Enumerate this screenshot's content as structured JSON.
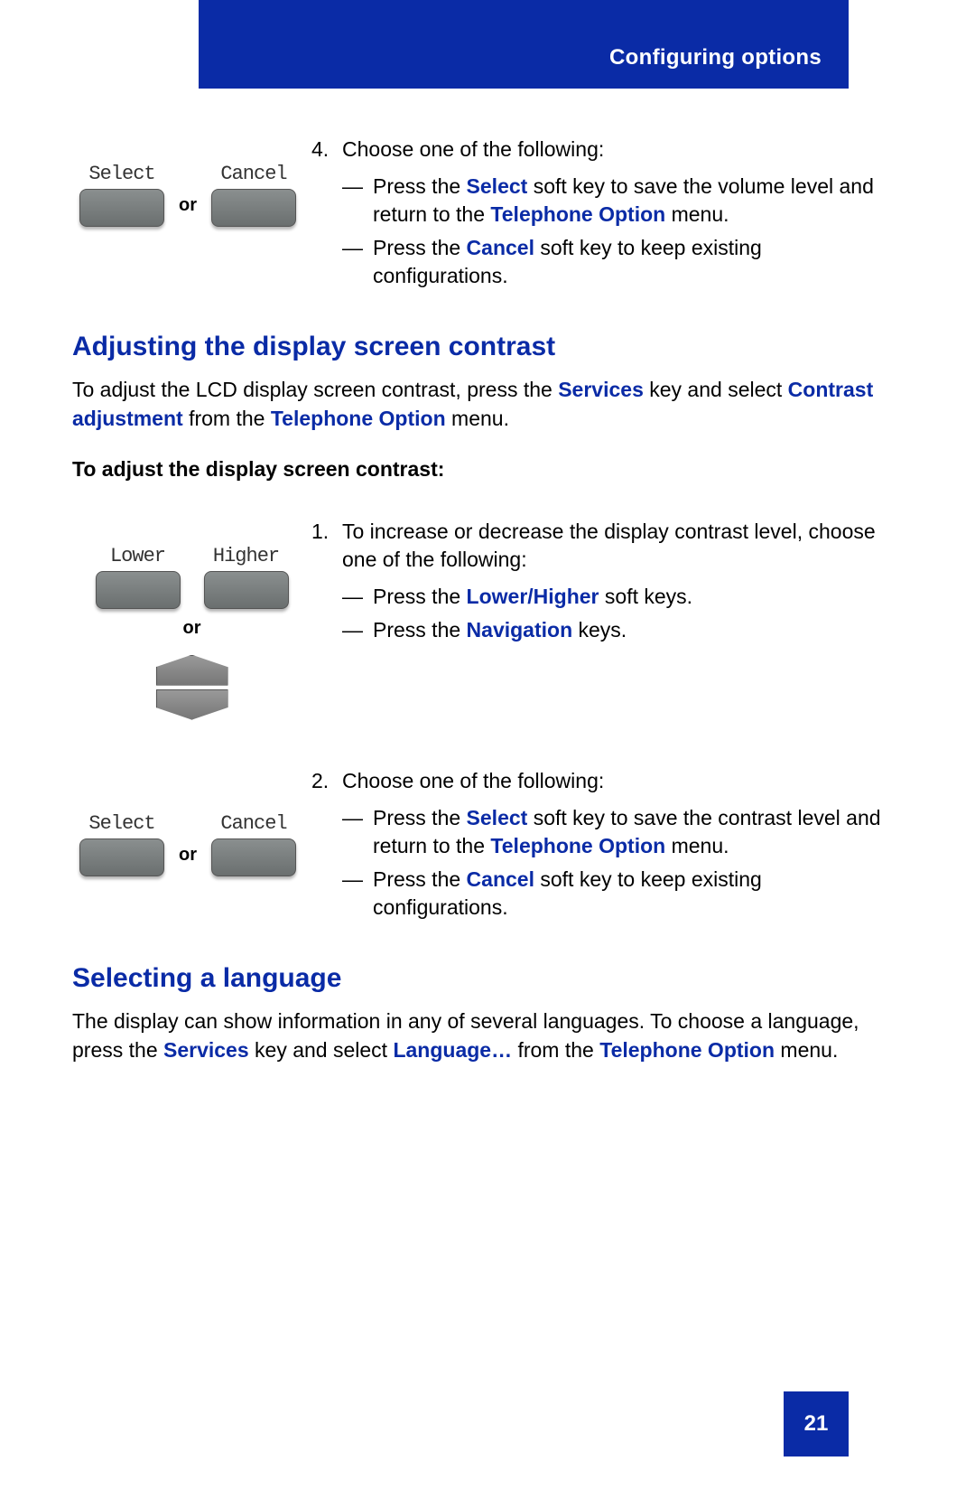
{
  "header": {
    "title": "Configuring options"
  },
  "step4": {
    "number": "4.",
    "lead": "Choose one of the following:",
    "a_pre": "Press the ",
    "a_key": "Select",
    "a_mid": " soft key to save the volume level and return to the ",
    "a_menu": "Telephone Option",
    "a_post": " menu.",
    "b_pre": "Press the ",
    "b_key": "Cancel",
    "b_post": " soft key to keep existing configurations.",
    "key1": "Select",
    "key2": "Cancel",
    "or": "or"
  },
  "sectionA": {
    "title": "Adjusting the display screen contrast",
    "intro_pre": "To adjust the LCD display screen contrast, press the ",
    "intro_k1": "Services",
    "intro_mid1": " key and select ",
    "intro_k2": "Contrast adjustment",
    "intro_mid2": " from the ",
    "intro_k3": "Telephone Option",
    "intro_post": " menu.",
    "subhead": "To adjust the display screen contrast:"
  },
  "stepA1": {
    "number": "1.",
    "lead": "To increase or decrease the display contrast level, choose one of the following:",
    "a_pre": "Press the ",
    "a_key": "Lower/Higher",
    "a_post": " soft keys.",
    "b_pre": "Press the ",
    "b_key": "Navigation",
    "b_post": " keys.",
    "key1": "Lower",
    "key2": "Higher",
    "or": "or"
  },
  "stepA2": {
    "number": "2.",
    "lead": "Choose one of the following:",
    "a_pre": "Press the ",
    "a_key": "Select",
    "a_mid": " soft key to save the contrast level and return to the ",
    "a_menu": "Telephone Option",
    "a_post": " menu.",
    "b_pre": "Press the ",
    "b_key": "Cancel",
    "b_post": " soft key to keep existing configurations.",
    "key1": "Select",
    "key2": "Cancel",
    "or": "or"
  },
  "sectionB": {
    "title": "Selecting a language",
    "intro_pre": "The display can show information in any of several languages. To choose a language, press the ",
    "intro_k1": "Services",
    "intro_mid1": " key and select ",
    "intro_k2": "Language…",
    "intro_mid2": " from the ",
    "intro_k3": "Telephone Option",
    "intro_post": " menu."
  },
  "footer": {
    "page": "21"
  }
}
